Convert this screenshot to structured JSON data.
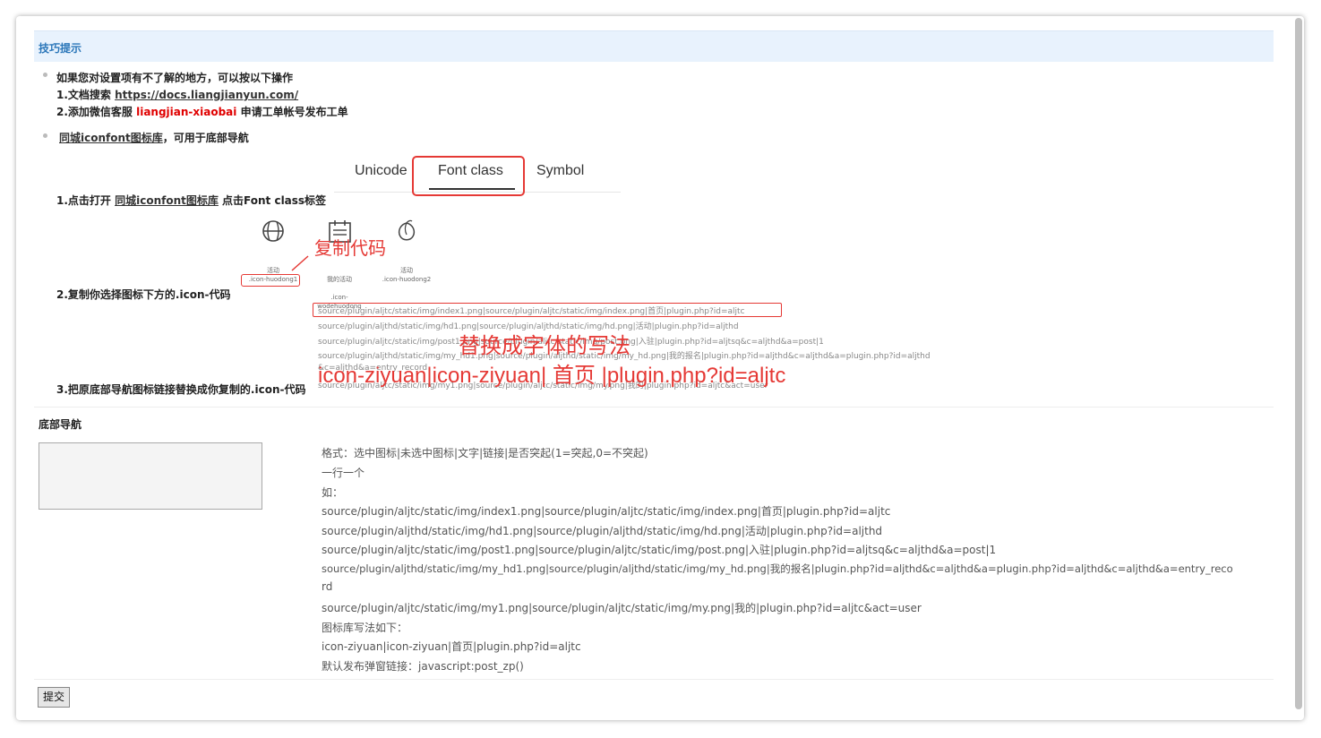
{
  "tip": {
    "title": "技巧提示",
    "item1_line1": "如果您对设置项有不了解的地方，可以按以下操作",
    "item1_line2_prefix": "1.文档搜索 ",
    "item1_line2_link": "https://docs.liangjianyun.com/",
    "item1_line3_prefix": "2.添加微信客服 ",
    "item1_line3_red": "liangjian-xiaobai",
    "item1_line3_suffix": " 申请工单帐号发布工单",
    "item2_link": "同城iconfont图标库",
    "item2_suffix": "，可用于底部导航",
    "step1_prefix": "1.点击打开 ",
    "step1_link": "同城iconfont图标库",
    "step1_suffix": " 点击Font class标签",
    "step2": "2.复制你选择图标下方的.icon-代码",
    "step3": "3.把原底部导航图标链接替换成你复制的.icon-代码"
  },
  "tabs": [
    "Unicode",
    "Font class",
    "Symbol"
  ],
  "icons": [
    {
      "icon": "basketball-icon",
      "label": "活动",
      "code": ".icon-huodong1"
    },
    {
      "icon": "calendar-icon",
      "label": "我的活动",
      "code": ".icon-\nwodehuodong"
    },
    {
      "icon": "peach-icon",
      "label": "活动",
      "code": ".icon-huodong2"
    }
  ],
  "annotations": {
    "copy_code": "复制代码",
    "replace_title": "替换成字体的写法",
    "replace_example": "icon-ziyuan|icon-ziyuan| 首页 |plugin.php?id=aljtc"
  },
  "code_lines": [
    "source/plugin/aljtc/static/img/index1.png|source/plugin/aljtc/static/img/index.png|首页|plugin.php?id=aljtc",
    "source/plugin/aljthd/static/img/hd1.png|source/plugin/aljthd/static/img/hd.png|活动|plugin.php?id=aljthd",
    "source/plugin/aljtc/static/img/post1.png|source/plugin/aljtc/static/img/post.png|入驻|plugin.php?id=aljtsq&c=aljthd&a=post|1",
    "source/plugin/aljthd/static/img/my_hd1.png|source/plugin/aljthd/static/img/my_hd.png|我的报名|plugin.php?id=aljthd&c=aljthd&a=plugin.php?id=aljthd",
    "&c=aljthd&a=entry_record",
    "source/plugin/aljtc/static/img/my1.png|source/plugin/aljtc/static/img/my.png|我的|plugin.php?id=aljtc&act=user"
  ],
  "field": {
    "label": "底部导航",
    "value": ""
  },
  "help": [
    "格式：选中图标|未选中图标|文字|链接|是否突起(1=突起,0=不突起)",
    "一行一个",
    "如：",
    "source/plugin/aljtc/static/img/index1.png|source/plugin/aljtc/static/img/index.png|首页|plugin.php?id=aljtc",
    "source/plugin/aljthd/static/img/hd1.png|source/plugin/aljthd/static/img/hd.png|活动|plugin.php?id=aljthd",
    "source/plugin/aljtc/static/img/post1.png|source/plugin/aljtc/static/img/post.png|入驻|plugin.php?id=aljtsq&c=aljthd&a=post|1",
    "source/plugin/aljthd/static/img/my_hd1.png|source/plugin/aljthd/static/img/my_hd.png|我的报名|plugin.php?id=aljthd&c=aljthd&a=plugin.php?id=aljthd&c=aljthd&a=entry_reco",
    "rd",
    "source/plugin/aljtc/static/img/my1.png|source/plugin/aljtc/static/img/my.png|我的|plugin.php?id=aljtc&act=user",
    "图标库写法如下：",
    "icon-ziyuan|icon-ziyuan|首页|plugin.php?id=aljtc",
    "默认发布弹窗链接：javascript:post_zp()"
  ],
  "submit_label": "提交",
  "colors": {
    "accent": "#2a76b9",
    "annotation": "#e53935",
    "header_bg": "#e8f2fd"
  }
}
